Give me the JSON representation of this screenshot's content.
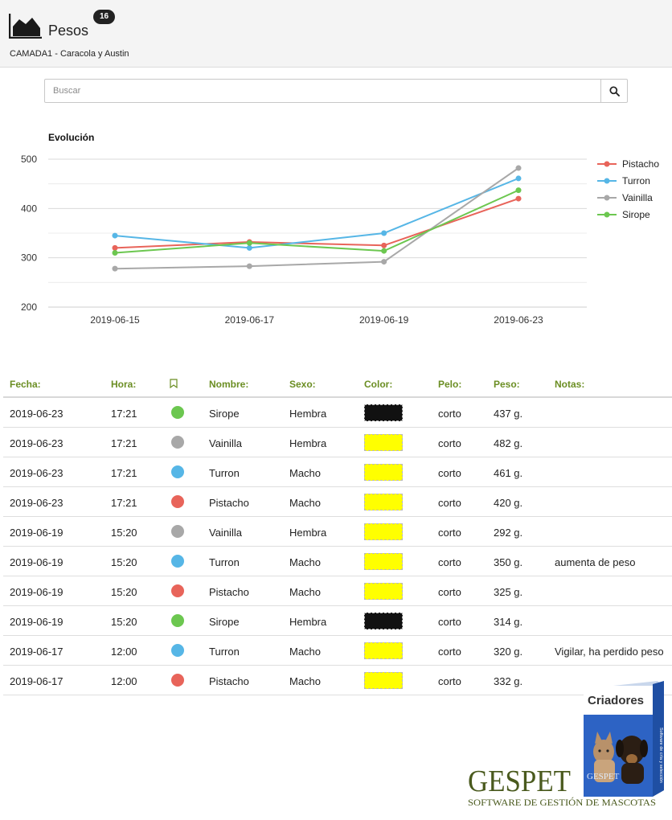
{
  "header": {
    "title": "Pesos",
    "badge": "16",
    "subtitle": "CAMADA1 - Caracola y Austin"
  },
  "search": {
    "placeholder": "Buscar"
  },
  "chart_data": {
    "type": "line",
    "title": "Evolución",
    "x": [
      "2019-06-15",
      "2019-06-17",
      "2019-06-19",
      "2019-06-23"
    ],
    "ylim": [
      200,
      500
    ],
    "yticks": [
      200,
      300,
      400,
      500
    ],
    "grid": true,
    "legend_position": "right",
    "series": [
      {
        "name": "Pistacho",
        "color": "#e8645a",
        "values": [
          320,
          332,
          325,
          420
        ]
      },
      {
        "name": "Turron",
        "color": "#56b6e6",
        "values": [
          345,
          320,
          350,
          461
        ]
      },
      {
        "name": "Vainilla",
        "color": "#a8a8a8",
        "values": [
          278,
          283,
          292,
          482
        ]
      },
      {
        "name": "Sirope",
        "color": "#6cc750",
        "values": [
          310,
          330,
          314,
          437
        ]
      }
    ]
  },
  "table": {
    "headers": {
      "fecha": "Fecha:",
      "hora": "Hora:",
      "nombre": "Nombre:",
      "sexo": "Sexo:",
      "color": "Color:",
      "pelo": "Pelo:",
      "peso": "Peso:",
      "notas": "Notas:"
    },
    "bookmark_icon": "bookmark-icon",
    "header_color": "#6b8e23",
    "rows": [
      {
        "fecha": "2019-06-23",
        "hora": "17:21",
        "dot_color": "#6cc750",
        "nombre": "Sirope",
        "sexo": "Hembra",
        "swatch": "#111111",
        "pelo": "corto",
        "peso": "437 g.",
        "notas": ""
      },
      {
        "fecha": "2019-06-23",
        "hora": "17:21",
        "dot_color": "#a8a8a8",
        "nombre": "Vainilla",
        "sexo": "Hembra",
        "swatch": "#ffff00",
        "pelo": "corto",
        "peso": "482 g.",
        "notas": ""
      },
      {
        "fecha": "2019-06-23",
        "hora": "17:21",
        "dot_color": "#56b6e6",
        "nombre": "Turron",
        "sexo": "Macho",
        "swatch": "#ffff00",
        "pelo": "corto",
        "peso": "461 g.",
        "notas": ""
      },
      {
        "fecha": "2019-06-23",
        "hora": "17:21",
        "dot_color": "#e8645a",
        "nombre": "Pistacho",
        "sexo": "Macho",
        "swatch": "#ffff00",
        "pelo": "corto",
        "peso": "420 g.",
        "notas": ""
      },
      {
        "fecha": "2019-06-19",
        "hora": "15:20",
        "dot_color": "#a8a8a8",
        "nombre": "Vainilla",
        "sexo": "Hembra",
        "swatch": "#ffff00",
        "pelo": "corto",
        "peso": "292 g.",
        "notas": ""
      },
      {
        "fecha": "2019-06-19",
        "hora": "15:20",
        "dot_color": "#56b6e6",
        "nombre": "Turron",
        "sexo": "Macho",
        "swatch": "#ffff00",
        "pelo": "corto",
        "peso": "350 g.",
        "notas": "aumenta de peso"
      },
      {
        "fecha": "2019-06-19",
        "hora": "15:20",
        "dot_color": "#e8645a",
        "nombre": "Pistacho",
        "sexo": "Macho",
        "swatch": "#ffff00",
        "pelo": "corto",
        "peso": "325 g.",
        "notas": ""
      },
      {
        "fecha": "2019-06-19",
        "hora": "15:20",
        "dot_color": "#6cc750",
        "nombre": "Sirope",
        "sexo": "Hembra",
        "swatch": "#111111",
        "pelo": "corto",
        "peso": "314 g.",
        "notas": ""
      },
      {
        "fecha": "2019-06-17",
        "hora": "12:00",
        "dot_color": "#56b6e6",
        "nombre": "Turron",
        "sexo": "Macho",
        "swatch": "#ffff00",
        "pelo": "corto",
        "peso": "320 g.",
        "notas": "Vigilar, ha perdido peso"
      },
      {
        "fecha": "2019-06-17",
        "hora": "12:00",
        "dot_color": "#e8645a",
        "nombre": "Pistacho",
        "sexo": "Macho",
        "swatch": "#ffff00",
        "pelo": "corto",
        "peso": "332 g.",
        "notas": ""
      }
    ]
  },
  "promo": {
    "logo_text": "GESPET",
    "tagline": "SOFTWARE DE GESTIÓN DE MASCOTAS",
    "box_title": "Criadores",
    "box_side_text": "Software de cría y selección",
    "box_brand": "GESPET",
    "brand_color": "#4a5a1e"
  }
}
